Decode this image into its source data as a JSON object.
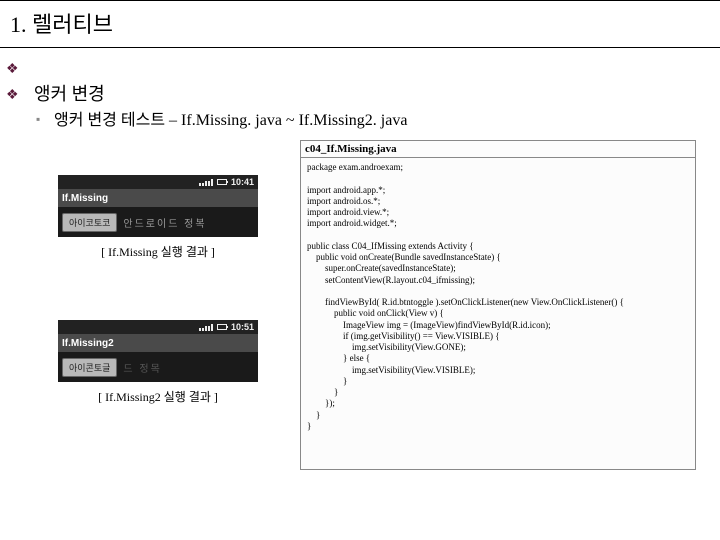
{
  "title": "1. 렐러티브",
  "section": "앵커 변경",
  "subsection": "앵커 변경 테스트 – If.Missing. java ~ If.Missing2. java",
  "screens": {
    "s1": {
      "time": "10:41",
      "app": "If.Missing",
      "button": "아이코토코",
      "watermark": "안드로이드 정복",
      "caption": "[ If.Missing 실행 결과 ]"
    },
    "s2": {
      "time": "10:51",
      "app": "If.Missing2",
      "button": "아이콘토글",
      "watermark": "드 정목",
      "caption": "[ If.Missing2 실행 결과 ]"
    }
  },
  "code": {
    "filename": "c04_If.Missing.java",
    "body": "package exam.androexam;\n\nimport android.app.*;\nimport android.os.*;\nimport android.view.*;\nimport android.widget.*;\n\npublic class C04_IfMissing extends Activity {\n    public void onCreate(Bundle savedInstanceState) {\n        super.onCreate(savedInstanceState);\n        setContentView(R.layout.c04_ifmissing);\n\n        findViewById( R.id.btntoggle ).setOnClickListener(new View.OnClickListener() {\n            public void onClick(View v) {\n                ImageView img = (ImageView)findViewById(R.id.icon);\n                if (img.getVisibility() == View.VISIBLE) {\n                    img.setVisibility(View.GONE);\n                } else {\n                    img.setVisibility(View.VISIBLE);\n                }\n            }\n        });\n    }\n}"
  }
}
